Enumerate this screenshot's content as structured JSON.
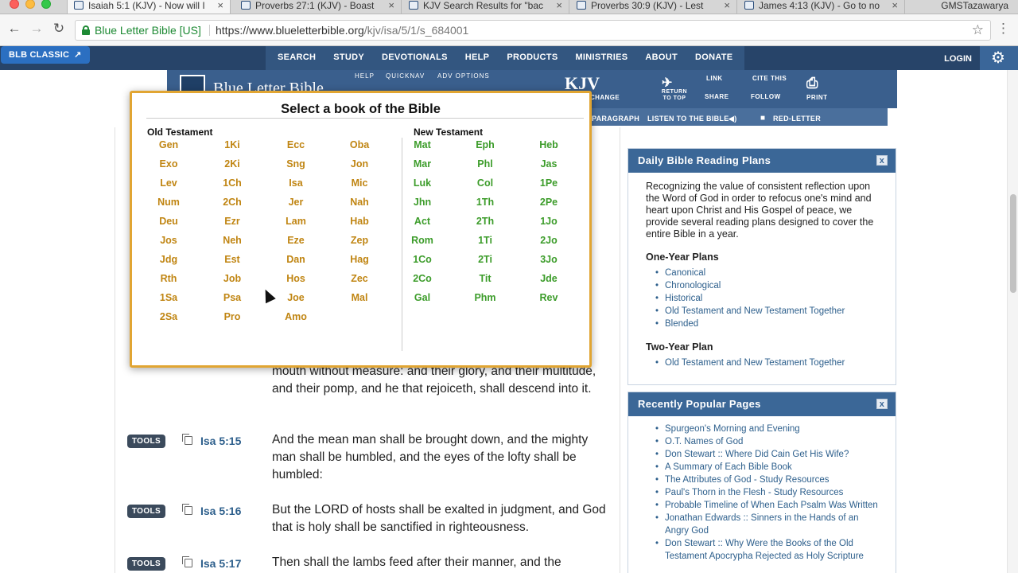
{
  "browser": {
    "tabs": [
      {
        "label": "Isaiah 5:1 (KJV) - Now will I",
        "active": true
      },
      {
        "label": "Proverbs 27:1 (KJV) - Boast",
        "active": false
      },
      {
        "label": "KJV Search Results for \"bac",
        "active": false
      },
      {
        "label": "Proverbs 30:9 (KJV) - Lest",
        "active": false
      },
      {
        "label": "James 4:13 (KJV) - Go to no",
        "active": false
      }
    ],
    "profile": "GMSTazawarya",
    "secure_label": "Blue Letter Bible [US]",
    "url_host": "https://www.blueletterbible.org",
    "url_path": "/kjv/isa/5/1/s_684001",
    "icons": {
      "back": "←",
      "forward": "→",
      "reload": "↻",
      "star": "☆",
      "menu": "⋮",
      "close": "×"
    }
  },
  "sitenav": {
    "classic_label": "BLB CLASSIC",
    "links": [
      "SEARCH",
      "STUDY",
      "DEVOTIONALS",
      "HELP",
      "PRODUCTS",
      "MINISTRIES",
      "ABOUT",
      "DONATE"
    ],
    "login": "LOGIN"
  },
  "header": {
    "title": "Blue Letter Bible",
    "help": "HELP",
    "quicknav": "QUICKNAV",
    "adv": "ADV OPTIONS",
    "version": "KJV",
    "version_sub": "CHANGE",
    "return_top": "RETURN TO TOP",
    "link": "LINK",
    "cite": "CITE THIS",
    "share": "SHARE",
    "follow": "FOLLOW",
    "print": "PRINT",
    "strip": [
      "PARAGRAPH",
      "LISTEN TO THE BIBLE",
      "RED-LETTER"
    ]
  },
  "modal": {
    "title": "Select a book of the Bible",
    "ot_label": "Old Testament",
    "nt_label": "New Testament",
    "ot_books": [
      "Gen",
      "Exo",
      "Lev",
      "Num",
      "Deu",
      "Jos",
      "Jdg",
      "Rth",
      "1Sa",
      "2Sa",
      "1Ki",
      "2Ki",
      "1Ch",
      "2Ch",
      "Ezr",
      "Neh",
      "Est",
      "Job",
      "Psa",
      "Pro",
      "Ecc",
      "Sng",
      "Isa",
      "Jer",
      "Lam",
      "Eze",
      "Dan",
      "Hos",
      "Joe",
      "Amo",
      "Oba",
      "Jon",
      "Mic",
      "Nah",
      "Hab",
      "Zep",
      "Hag",
      "Zec",
      "Mal"
    ],
    "nt_books": [
      "Mat",
      "Mar",
      "Luk",
      "Jhn",
      "Act",
      "Rom",
      "1Co",
      "2Co",
      "Gal",
      "Eph",
      "Phl",
      "Col",
      "1Th",
      "2Th",
      "1Ti",
      "2Ti",
      "Tit",
      "Phm",
      "Heb",
      "Jas",
      "1Pe",
      "2Pe",
      "1Jo",
      "2Jo",
      "3Jo",
      "Jde",
      "Rev"
    ]
  },
  "verses": {
    "partial_text": "mouth without measure: and their glory, and their multitude, and their pomp, and he that rejoiceth, shall descend into it.",
    "rows": [
      {
        "tools": "TOOLS",
        "ref": "Isa 5:15",
        "text": "And the mean man shall be brought down, and the mighty man shall be humbled, and the eyes of the lofty shall be humbled:"
      },
      {
        "tools": "TOOLS",
        "ref": "Isa 5:16",
        "text": "But the LORD of hosts shall be exalted in judgment, and God that is holy shall be sanctified in righteousness."
      },
      {
        "tools": "TOOLS",
        "ref": "Isa 5:17",
        "text": "Then shall the lambs feed after their manner, and the"
      }
    ]
  },
  "sidebar": {
    "reading_plans": {
      "title": "Daily Bible Reading Plans",
      "intro": "Recognizing the value of consistent reflection upon the Word of God in order to refocus one's mind and heart upon Christ and His Gospel of peace, we provide several reading plans designed to cover the entire Bible in a year.",
      "one_year_heading": "One-Year Plans",
      "one_year": [
        "Canonical",
        "Chronological",
        "Historical",
        "Old Testament and New Testament Together",
        "Blended"
      ],
      "two_year_heading": "Two-Year Plan",
      "two_year": [
        "Old Testament and New Testament Together"
      ]
    },
    "popular": {
      "title": "Recently Popular Pages",
      "items": [
        "Spurgeon's Morning and Evening",
        "O.T. Names of God",
        "Don Stewart :: Where Did Cain Get His Wife?",
        "A Summary of Each Bible Book",
        "The Attributes of God - Study Resources",
        "Paul's Thorn in the Flesh - Study Resources",
        "Probable Timeline of When Each Psalm Was Written",
        "Jonathan Edwards :: Sinners in the Hands of an Angry God",
        "Don Stewart :: Why Were the Books of the Old Testament Apocrypha Rejected as Holy Scripture"
      ]
    },
    "close_glyph": "x"
  },
  "colors": {
    "nav_bg": "#274469",
    "modal_border": "#e1a532",
    "ot_book": "#c08512",
    "nt_book": "#3c9c2a",
    "panel_head": "#3b6797"
  }
}
